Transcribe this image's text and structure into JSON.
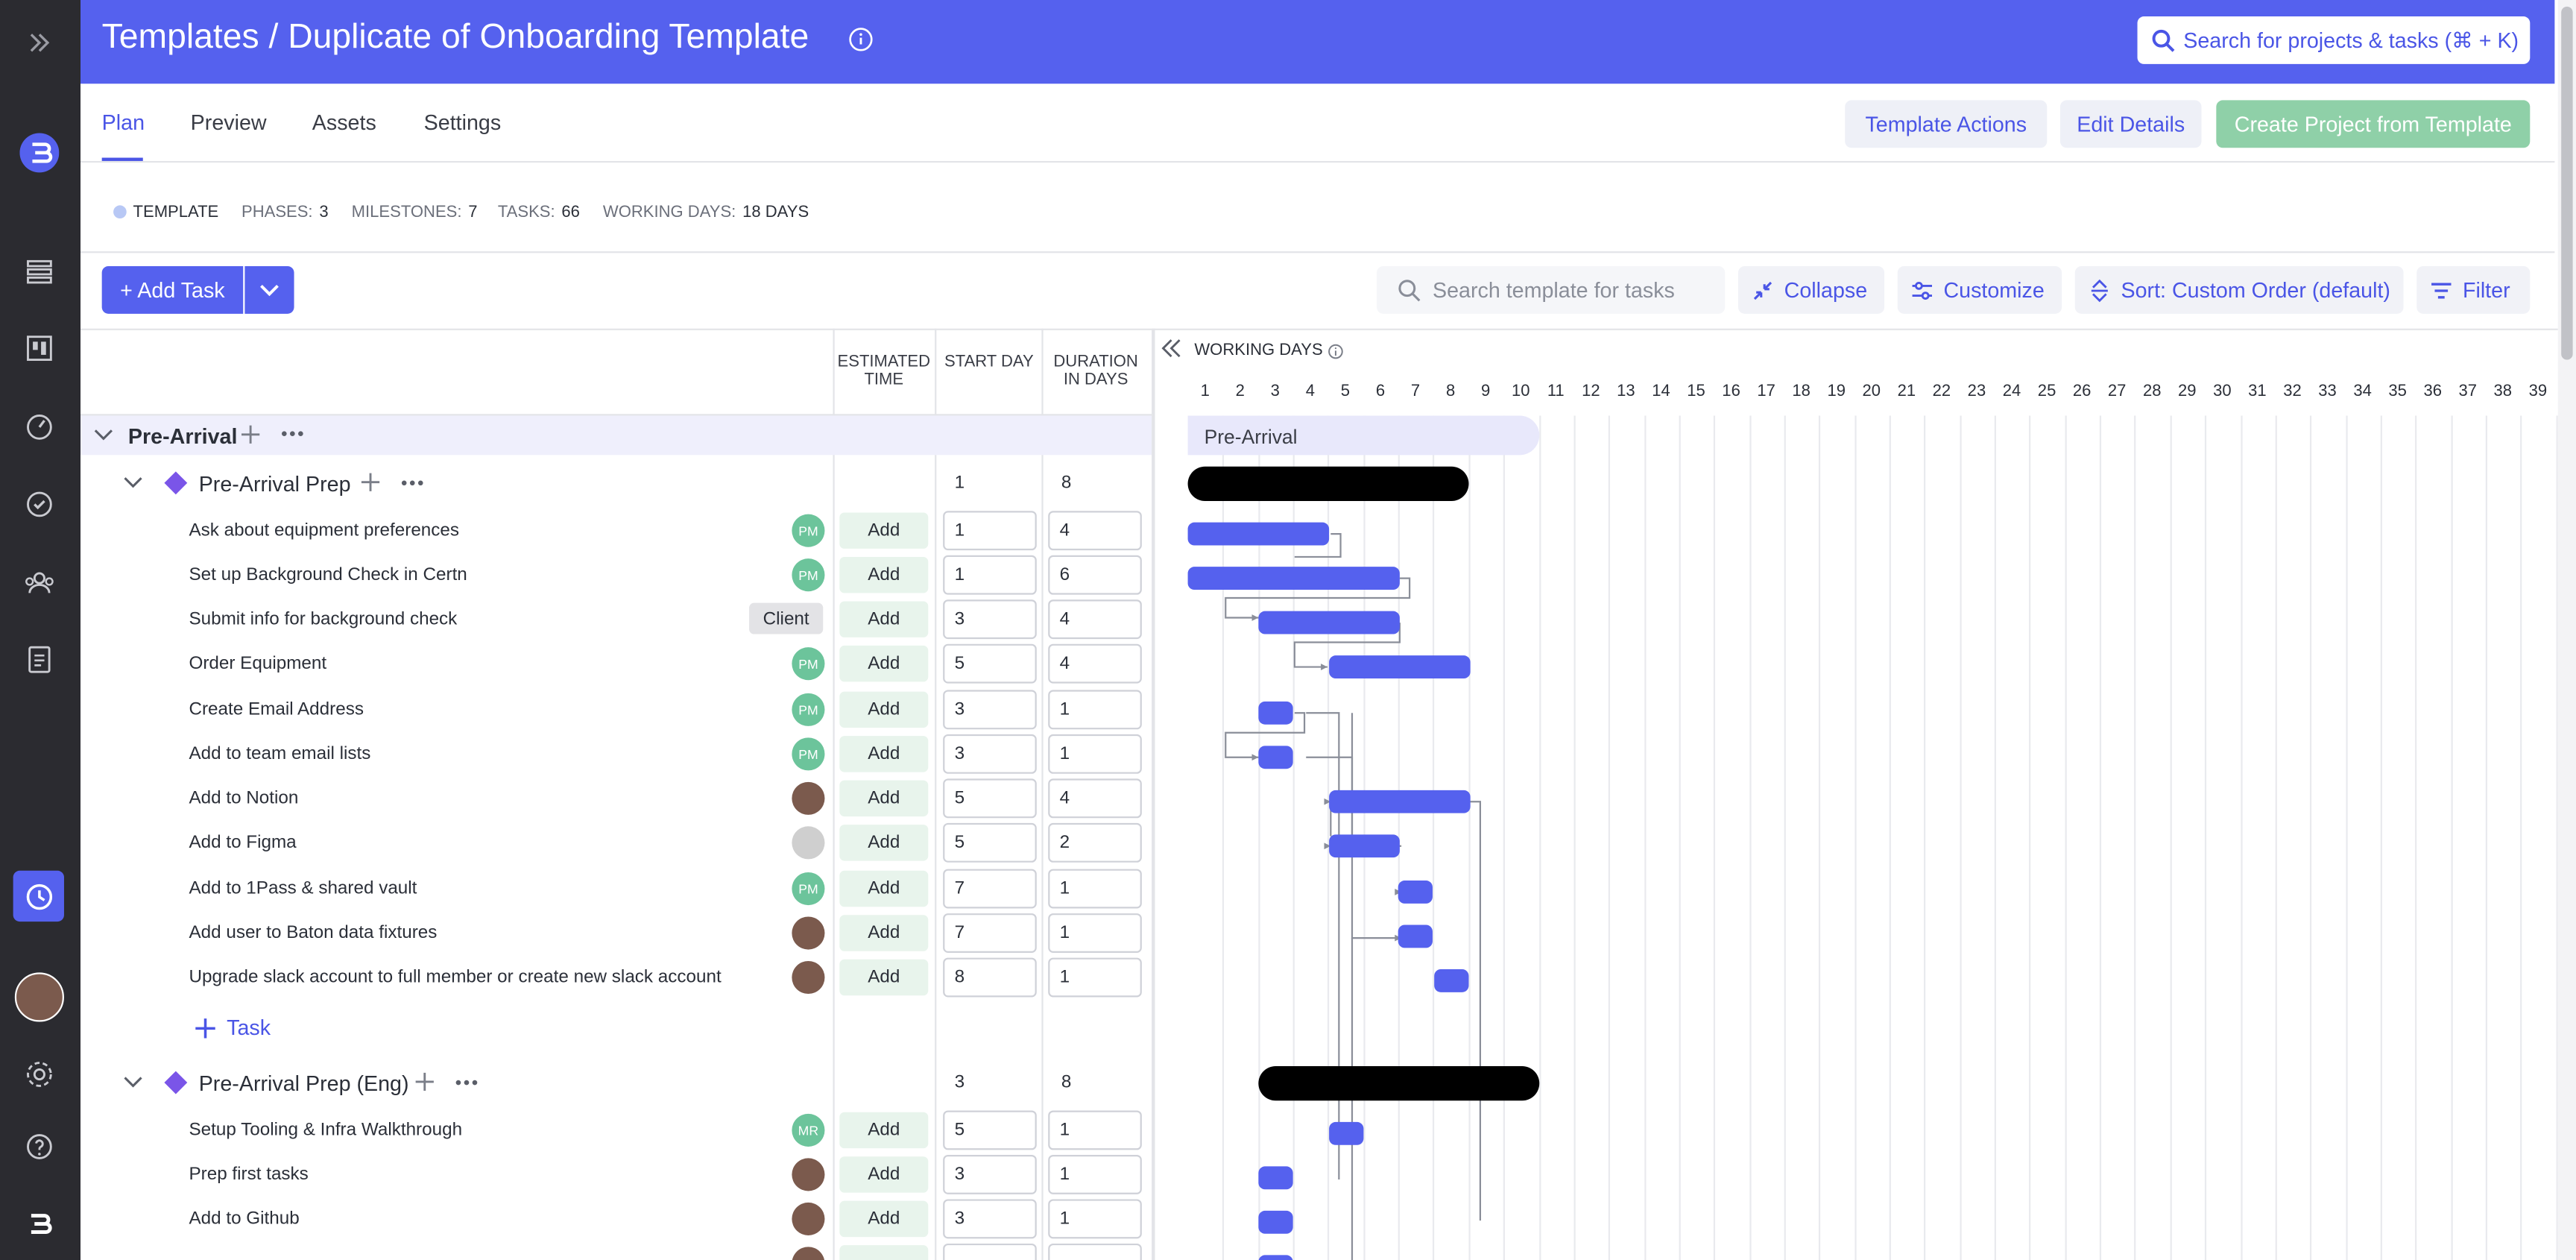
{
  "header": {
    "title": "Templates / Duplicate of Onboarding Template",
    "search_label": "Search for projects & tasks (⌘ + K)"
  },
  "tabs": [
    "Plan",
    "Preview",
    "Assets",
    "Settings"
  ],
  "actions": {
    "template_actions": "Template Actions",
    "edit_details": "Edit Details",
    "create_project": "Create Project from Template"
  },
  "stats": {
    "template": "TEMPLATE",
    "phases_label": "PHASES:",
    "phases": "3",
    "milestones_label": "MILESTONES:",
    "milestones": "7",
    "tasks_label": "TASKS:",
    "tasks": "66",
    "working_days_label": "WORKING DAYS:",
    "working_days": "18 DAYS"
  },
  "toolbar": {
    "add_task": "+ Add Task",
    "search_placeholder": "Search template for tasks",
    "collapse": "Collapse",
    "customize": "Customize",
    "sort": "Sort: Custom Order (default)",
    "filter": "Filter"
  },
  "columns": {
    "estimated_time": "ESTIMATED TIME",
    "start_day": "START DAY",
    "duration": "DURATION IN DAYS",
    "working_days": "WORKING DAYS"
  },
  "days": [
    "1",
    "2",
    "3",
    "4",
    "5",
    "6",
    "7",
    "8",
    "9",
    "10",
    "11",
    "12",
    "13",
    "14",
    "15",
    "16",
    "17",
    "18",
    "19",
    "20",
    "21",
    "22",
    "23",
    "24",
    "25",
    "26",
    "27",
    "28",
    "29",
    "30",
    "31",
    "32",
    "33",
    "34",
    "35",
    "36",
    "37",
    "38",
    "39"
  ],
  "phase": {
    "name": "Pre-Arrival",
    "gantt_label": "Pre-Arrival"
  },
  "milestone1": {
    "name": "Pre-Arrival Prep",
    "start": "1",
    "duration": "8",
    "tasks": [
      {
        "name": "Ask about equipment preferences",
        "assignee": "PM",
        "add": "Add",
        "start": "1",
        "duration": "4"
      },
      {
        "name": "Set up Background Check in Certn",
        "assignee": "PM",
        "add": "Add",
        "start": "1",
        "duration": "6"
      },
      {
        "name": "Submit info for background check",
        "assignee": "Client",
        "add": "Add",
        "start": "3",
        "duration": "4"
      },
      {
        "name": "Order Equipment",
        "assignee": "PM",
        "add": "Add",
        "start": "5",
        "duration": "4"
      },
      {
        "name": "Create Email Address",
        "assignee": "PM",
        "add": "Add",
        "start": "3",
        "duration": "1"
      },
      {
        "name": "Add to team email lists",
        "assignee": "PM",
        "add": "Add",
        "start": "3",
        "duration": "1"
      },
      {
        "name": "Add to Notion",
        "assignee": "",
        "add": "Add",
        "start": "5",
        "duration": "4"
      },
      {
        "name": "Add to Figma",
        "assignee": "",
        "add": "Add",
        "start": "5",
        "duration": "2"
      },
      {
        "name": "Add to 1Pass & shared vault",
        "assignee": "PM",
        "add": "Add",
        "start": "7",
        "duration": "1"
      },
      {
        "name": "Add user to Baton data fixtures",
        "assignee": "",
        "add": "Add",
        "start": "7",
        "duration": "1"
      },
      {
        "name": "Upgrade slack account to full member or create new slack account",
        "assignee": "",
        "add": "Add",
        "start": "8",
        "duration": "1"
      }
    ],
    "add_task_label": "Task"
  },
  "milestone2": {
    "name": "Pre-Arrival Prep (Eng)",
    "start": "3",
    "duration": "8",
    "tasks": [
      {
        "name": "Setup Tooling & Infra Walkthrough",
        "assignee": "MR",
        "add": "Add",
        "start": "5",
        "duration": "1"
      },
      {
        "name": "Prep first tasks",
        "assignee": "",
        "add": "Add",
        "start": "3",
        "duration": "1"
      },
      {
        "name": "Add to Github",
        "assignee": "",
        "add": "Add",
        "start": "3",
        "duration": "1"
      }
    ]
  },
  "colors": {
    "accent": "#5561ee",
    "nav": "#2b2b30",
    "create_btn": "#8fd0a8"
  }
}
